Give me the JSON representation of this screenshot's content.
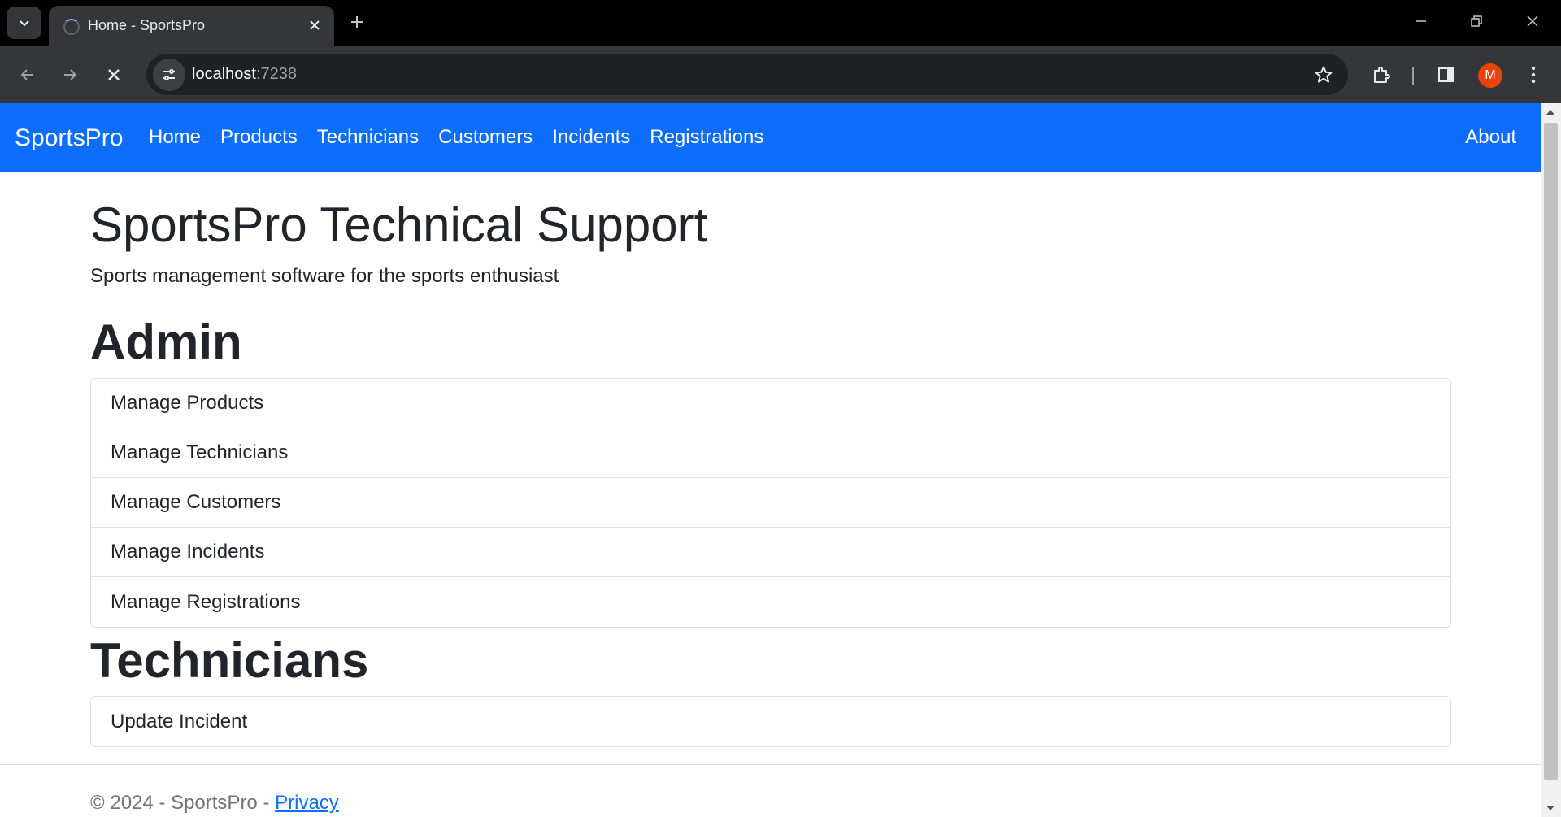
{
  "browser": {
    "tab_title": "Home - SportsPro",
    "url_host": "localhost",
    "url_port": ":7238",
    "profile_initial": "M",
    "accent_color": "#0d6efd"
  },
  "navbar": {
    "brand": "SportsPro",
    "links": [
      {
        "label": "Home"
      },
      {
        "label": "Products"
      },
      {
        "label": "Technicians"
      },
      {
        "label": "Customers"
      },
      {
        "label": "Incidents"
      },
      {
        "label": "Registrations"
      }
    ],
    "about": "About"
  },
  "main": {
    "title": "SportsPro Technical Support",
    "subtitle": "Sports management software for the sports enthusiast",
    "admin": {
      "heading": "Admin",
      "items": [
        {
          "label": "Manage Products"
        },
        {
          "label": "Manage Technicians"
        },
        {
          "label": "Manage Customers"
        },
        {
          "label": "Manage Incidents"
        },
        {
          "label": "Manage Registrations"
        }
      ]
    },
    "technicians": {
      "heading": "Technicians",
      "items": [
        {
          "label": "Update Incident"
        }
      ]
    }
  },
  "footer": {
    "copyright": "© 2024 - SportsPro - ",
    "privacy_link": "Privacy"
  }
}
